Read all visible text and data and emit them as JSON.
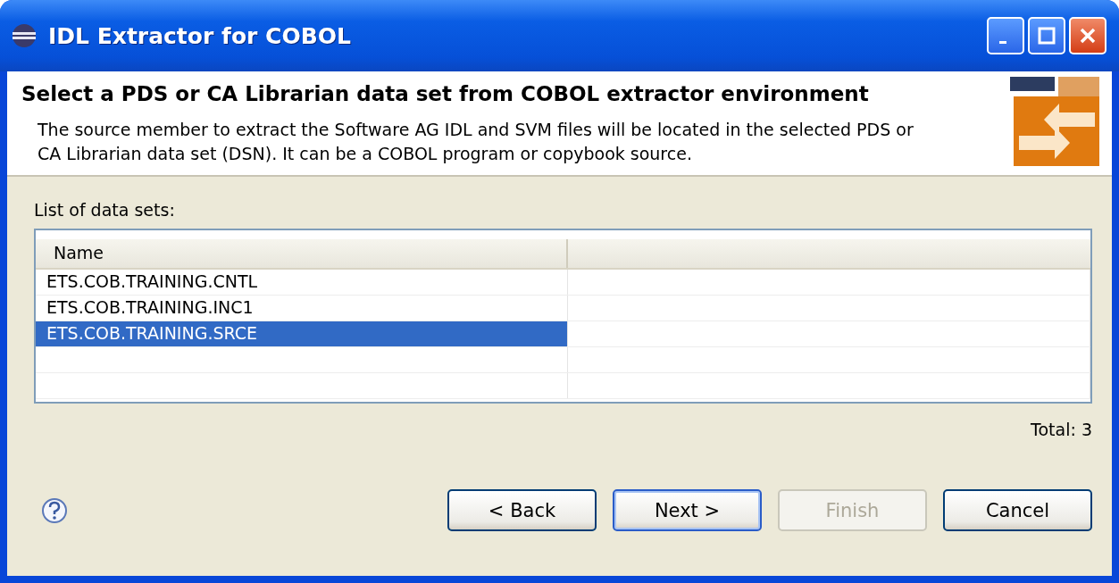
{
  "window": {
    "title": "IDL Extractor for COBOL",
    "controls": [
      {
        "kind": "minimize"
      },
      {
        "kind": "maximize"
      },
      {
        "kind": "close"
      }
    ]
  },
  "header": {
    "title": "Select a PDS or CA Librarian data set from COBOL extractor environment",
    "description": "The source member to extract the Software AG IDL and SVM files will be located in the selected PDS or CA Librarian data set (DSN). It can be a COBOL program or copybook source."
  },
  "list_label": "List of data sets:",
  "table": {
    "columns": [
      "Name"
    ],
    "rows": [
      {
        "name": "ETS.COB.TRAINING.CNTL",
        "selected": false
      },
      {
        "name": "ETS.COB.TRAINING.INC1",
        "selected": false
      },
      {
        "name": "ETS.COB.TRAINING.SRCE",
        "selected": true
      }
    ]
  },
  "total": "Total: 3",
  "buttons": [
    {
      "label": "< Back",
      "disabled": false,
      "default": false
    },
    {
      "label": "Next >",
      "disabled": false,
      "default": true
    },
    {
      "label": "Finish",
      "disabled": true,
      "default": false
    },
    {
      "label": "Cancel",
      "disabled": false,
      "default": false
    }
  ]
}
